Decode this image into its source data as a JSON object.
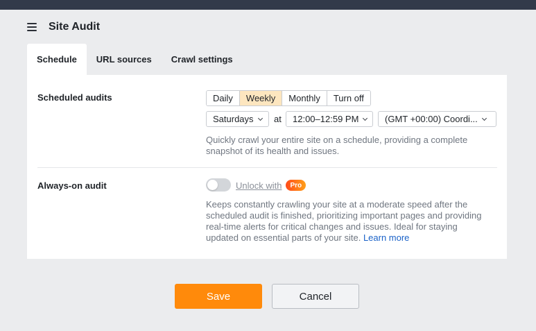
{
  "header": {
    "title": "Site Audit",
    "menu_icon": "hamburger-menu-icon"
  },
  "tabs": [
    {
      "label": "Schedule",
      "active": true
    },
    {
      "label": "URL sources",
      "active": false
    },
    {
      "label": "Crawl settings",
      "active": false
    }
  ],
  "scheduled": {
    "label": "Scheduled audits",
    "frequency_options": [
      "Daily",
      "Weekly",
      "Monthly",
      "Turn off"
    ],
    "selected_frequency": "Weekly",
    "day_value": "Saturdays",
    "at_label": "at",
    "time_value": "12:00–12:59 PM",
    "timezone_value": "(GMT +00:00) Coordi...",
    "description_lines": [
      "Quickly crawl your entire site on a schedule, providing a complete",
      "snapshot of its health and issues."
    ]
  },
  "always_on": {
    "label": "Always-on audit",
    "toggle_on": false,
    "unlock_text": "Unlock with",
    "pro_badge": "Pro",
    "description_lines": [
      "Keeps constantly crawling your site at a moderate speed after the",
      "scheduled audit is finished, prioritizing important pages and providing",
      "real-time alerts for critical changes and issues. Ideal for staying",
      "updated on essential parts of your site."
    ],
    "learn_more": "Learn more"
  },
  "actions": {
    "save_label": "Save",
    "cancel_label": "Cancel"
  },
  "colors": {
    "accent": "#ff8a0b",
    "selected_segment": "#fde6bf",
    "link": "#1a62c8",
    "topbar": "#323a4a"
  }
}
